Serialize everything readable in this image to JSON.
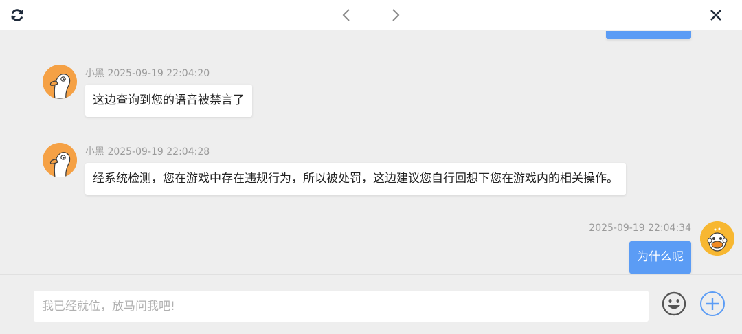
{
  "toolbar": {
    "refresh_icon": "refresh-icon",
    "prev_icon": "chevron-left-icon",
    "next_icon": "chevron-right-icon",
    "close_icon": "close-icon"
  },
  "messages": [
    {
      "sender": "小黑",
      "time": "2025-09-19 22:04:20",
      "text": "这边查询到您的语音被禁言了",
      "side": "left"
    },
    {
      "sender": "小黑",
      "time": "2025-09-19 22:04:28",
      "text": "经系统检测，您在游戏中存在违规行为，所以被处罚，这边建议您自行回想下您在游戏内的相关操作。",
      "side": "left"
    },
    {
      "sender": "",
      "time": "2025-09-19 22:04:34",
      "text": "为什么呢",
      "side": "right"
    }
  ],
  "composer": {
    "placeholder": "我已经就位，放马问我吧!",
    "value": "",
    "emoji_icon": "emoji-icon",
    "add_icon": "plus-circle-icon"
  },
  "colors": {
    "accent": "#5b9cf5",
    "avatar_bg": "#f5a145",
    "background": "#eeeeee"
  }
}
